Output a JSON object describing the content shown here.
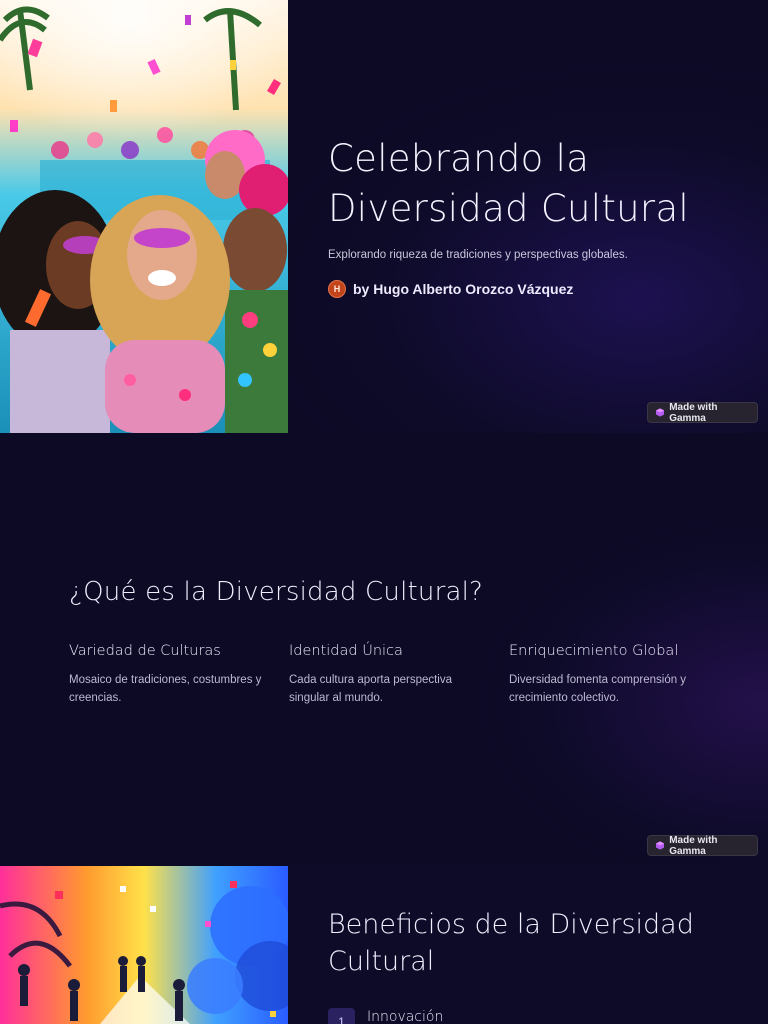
{
  "slide1": {
    "title_line1": "Celebrando la",
    "title_line2": "Diversidad Cultural",
    "subtitle": "Explorando riqueza de tradiciones y perspectivas globales.",
    "author_initial": "H",
    "author": "by Hugo Alberto Orozco Vázquez",
    "badge": "Made with Gamma"
  },
  "slide2": {
    "title": "¿Qué es la Diversidad Cultural?",
    "columns": [
      {
        "heading": "Variedad de Culturas",
        "text": "Mosaico de tradiciones, costumbres y creencias."
      },
      {
        "heading": "Identidad Única",
        "text": "Cada cultura aporta perspectiva singular al mundo."
      },
      {
        "heading": "Enriquecimiento Global",
        "text": "Diversidad fomenta comprensión y crecimiento colectivo."
      }
    ],
    "badge": "Made with Gamma"
  },
  "slide3": {
    "title_line1": "Beneficios de la Diversidad",
    "title_line2": "Cultural",
    "items": [
      {
        "number": "1",
        "label": "Innovación"
      }
    ]
  },
  "colors": {
    "background": "#0c0a24",
    "accent": "#2a2260",
    "avatar": "#c2441a"
  }
}
